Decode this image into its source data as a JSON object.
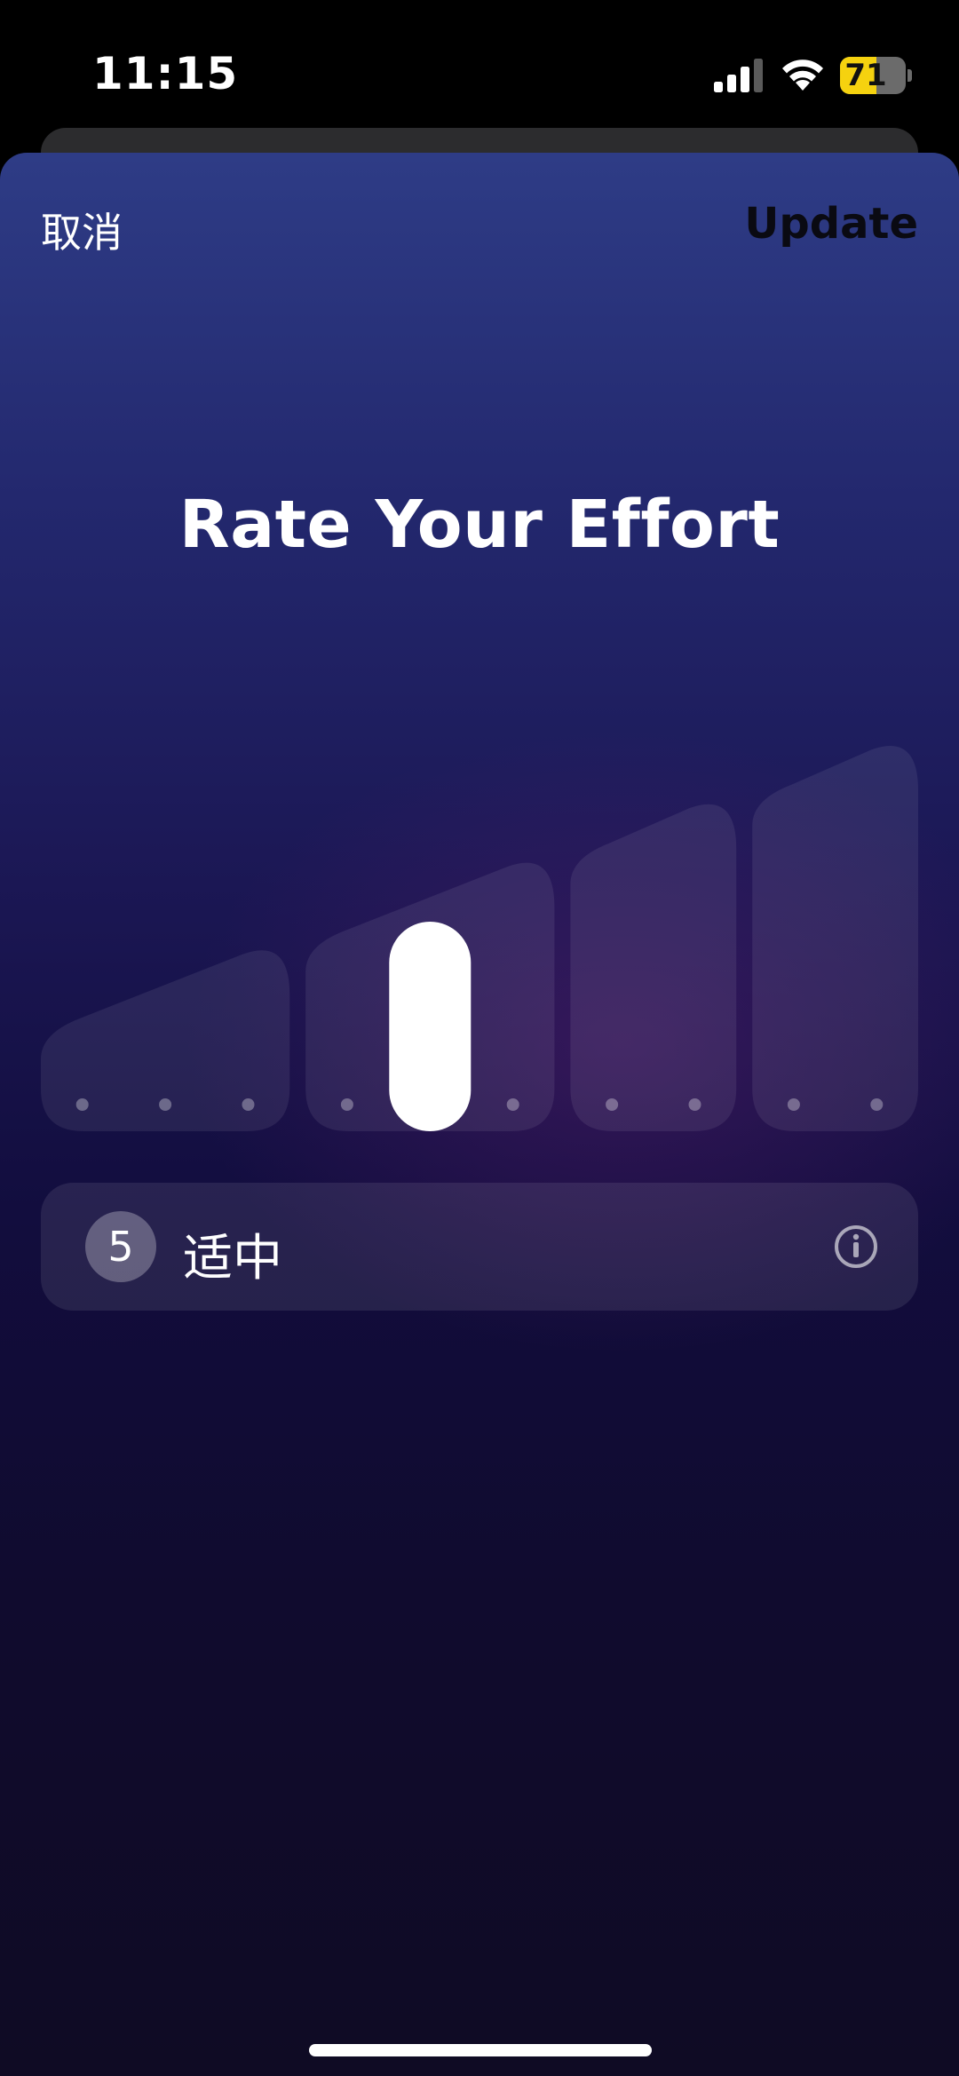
{
  "status_bar": {
    "time": "11:15",
    "battery_percent": 71,
    "battery_text": "71"
  },
  "header": {
    "cancel_label": "取消",
    "update_label": "Update"
  },
  "title": "Rate Your Effort",
  "effort_scale": {
    "max": 10,
    "selected": 5,
    "groups": [
      {
        "levels": [
          1,
          2,
          3
        ]
      },
      {
        "levels": [
          4,
          5,
          6
        ]
      },
      {
        "levels": [
          7,
          8
        ]
      },
      {
        "levels": [
          9,
          10
        ]
      }
    ]
  },
  "rating": {
    "value": "5",
    "label": "适中"
  },
  "colors": {
    "accent": "#ffffff",
    "battery": "#f5d20f",
    "sheet_top": "#2e3c86",
    "sheet_bottom": "#0f0b24"
  },
  "icons": {
    "info": "info-circle-icon",
    "signal": "cellular-signal-icon",
    "wifi": "wifi-icon"
  }
}
